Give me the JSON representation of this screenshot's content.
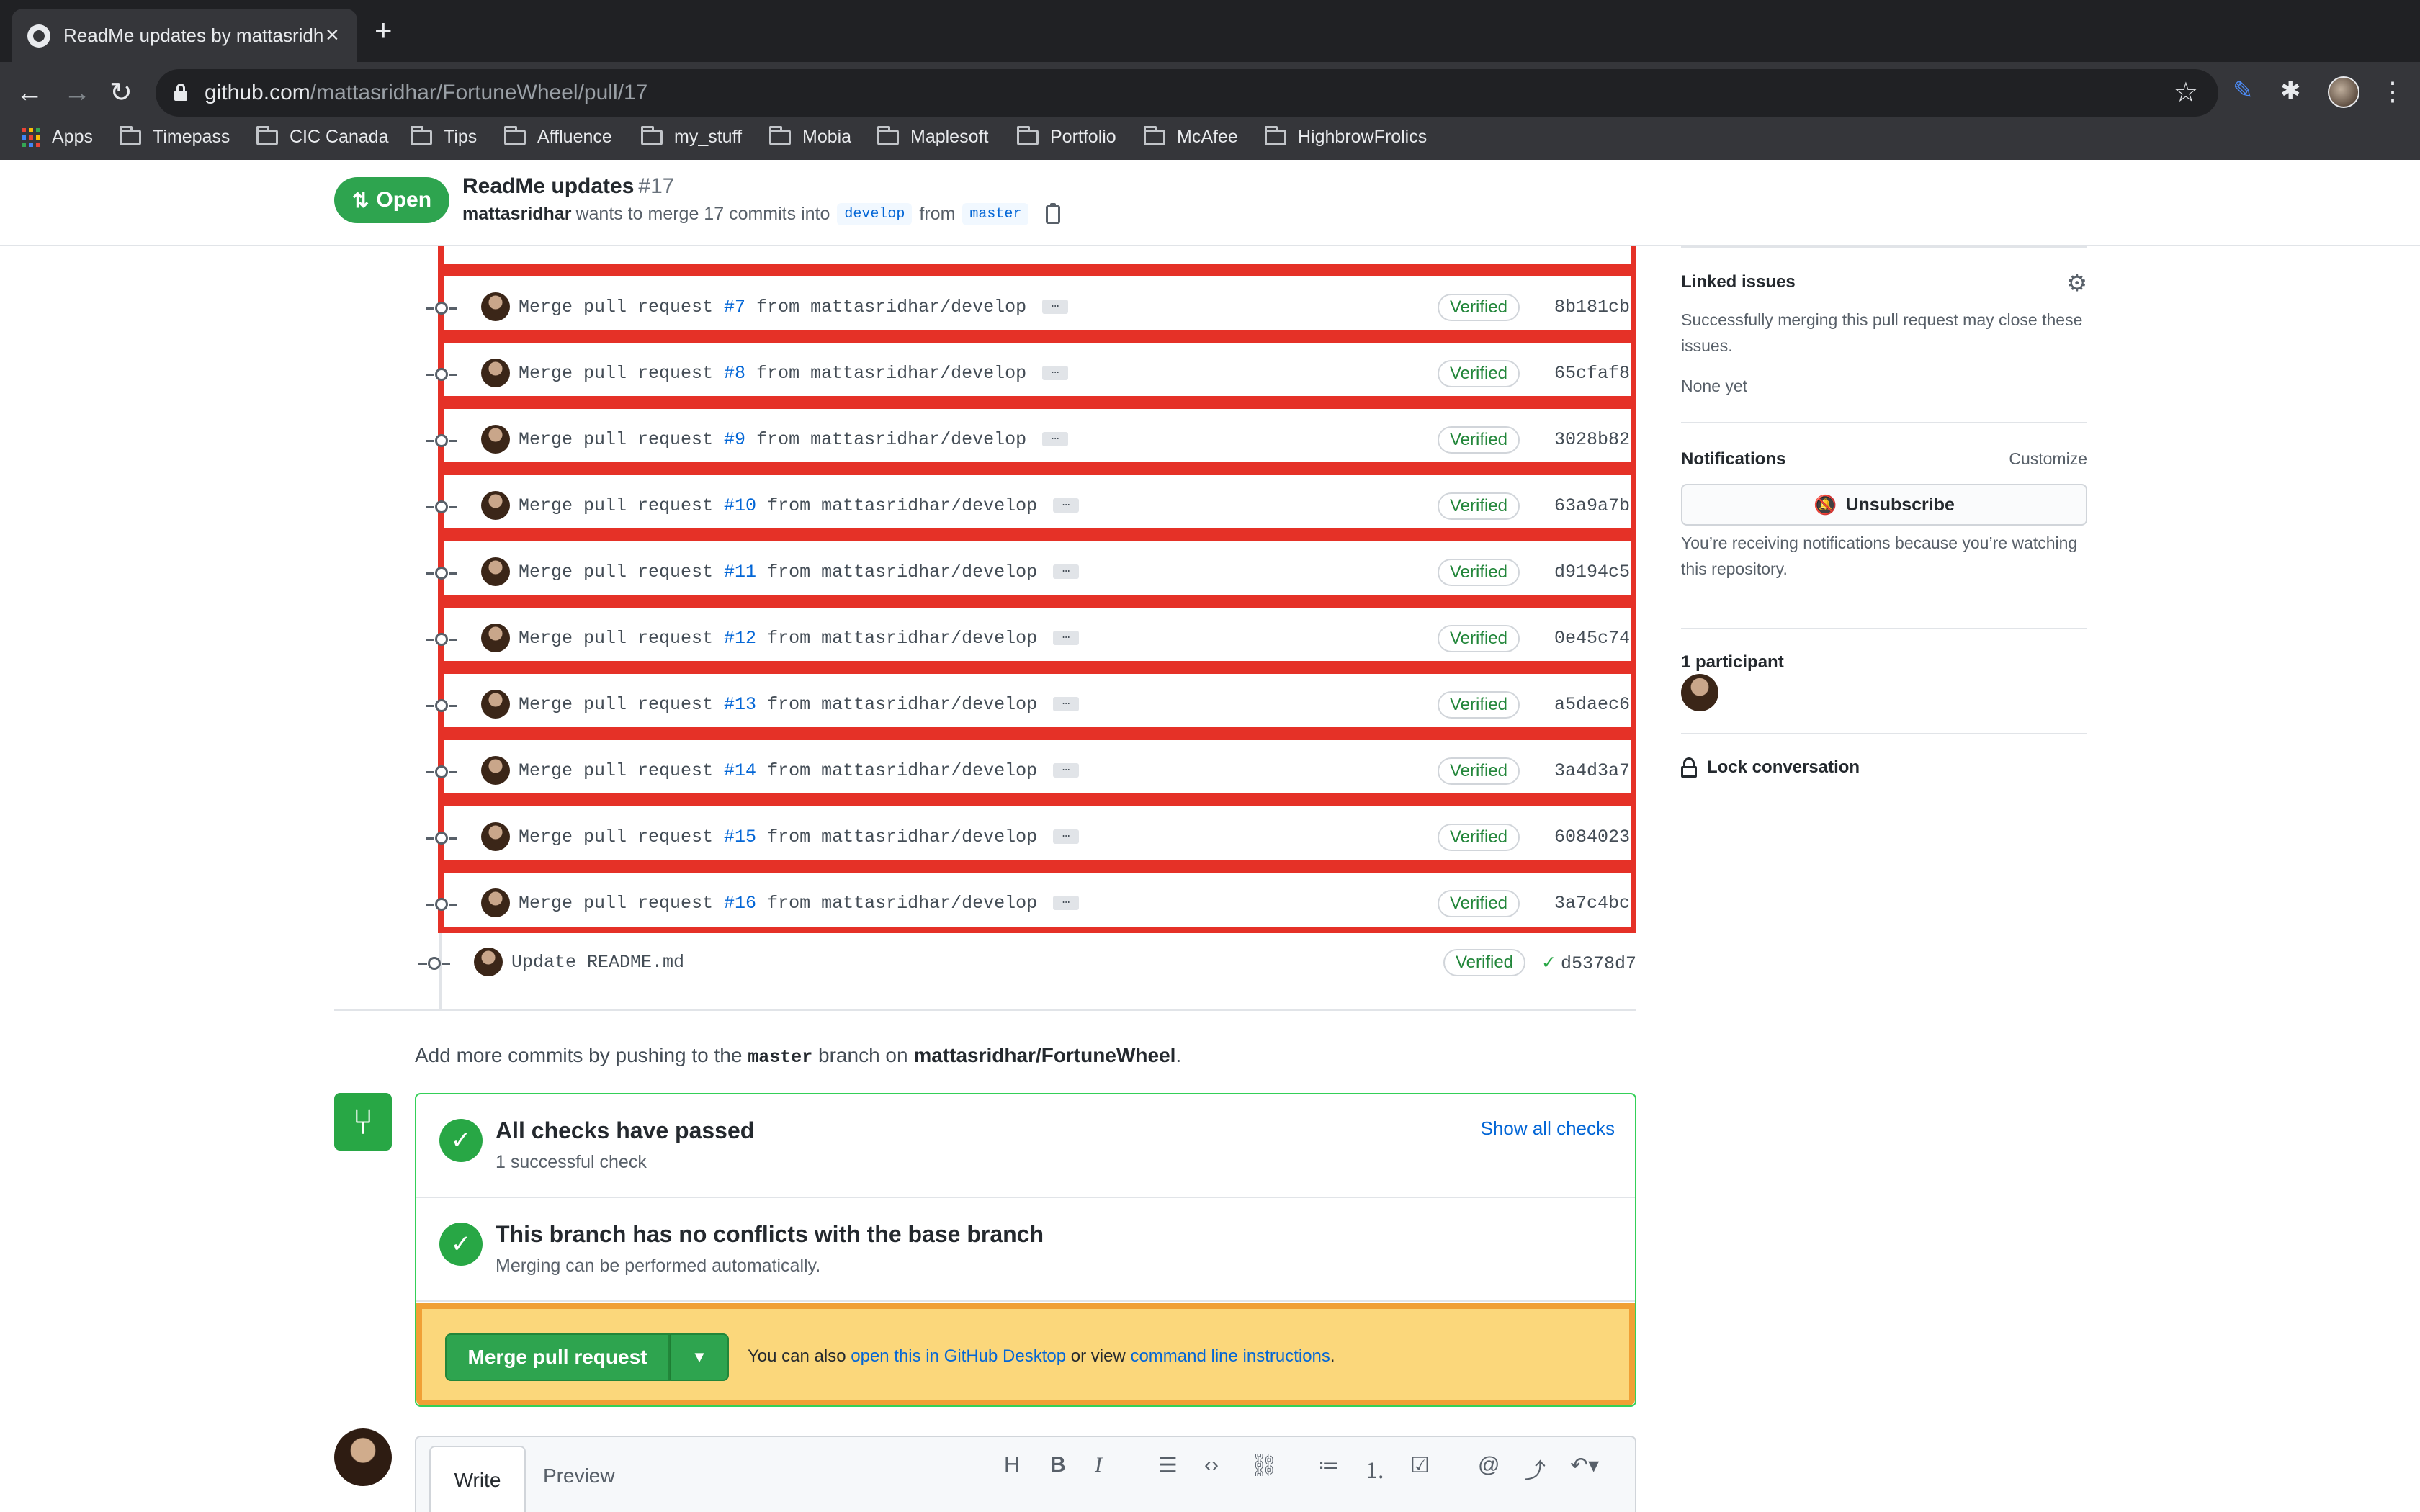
{
  "browser": {
    "tab_title": "ReadMe updates by mattasridhar",
    "url_host": "github.com",
    "url_path": "/mattasridhar/FortuneWheel/pull/17",
    "bookmarks": [
      "Apps",
      "Timepass",
      "CIC Canada",
      "Tips",
      "Affluence",
      "my_stuff",
      "Mobia",
      "Maplesoft",
      "Portfolio",
      "McAfee",
      "HighbrowFrolics"
    ]
  },
  "pr_header": {
    "status": "Open",
    "title": "ReadMe updates",
    "number": "#17",
    "author": "mattasridhar",
    "meta_text": "wants to merge 17 commits into",
    "base_branch": "develop",
    "from_text": "from",
    "head_branch": "master"
  },
  "commits": [
    {
      "prefix": "Merge pull request ",
      "pr": "#7",
      "suffix": " from mattasridhar/develop",
      "badge": "Verified",
      "sha": "8b181cb"
    },
    {
      "prefix": "Merge pull request ",
      "pr": "#8",
      "suffix": " from mattasridhar/develop",
      "badge": "Verified",
      "sha": "65cfaf8"
    },
    {
      "prefix": "Merge pull request ",
      "pr": "#9",
      "suffix": " from mattasridhar/develop",
      "badge": "Verified",
      "sha": "3028b82"
    },
    {
      "prefix": "Merge pull request ",
      "pr": "#10",
      "suffix": " from mattasridhar/develop",
      "badge": "Verified",
      "sha": "63a9a7b"
    },
    {
      "prefix": "Merge pull request ",
      "pr": "#11",
      "suffix": " from mattasridhar/develop",
      "badge": "Verified",
      "sha": "d9194c5"
    },
    {
      "prefix": "Merge pull request ",
      "pr": "#12",
      "suffix": " from mattasridhar/develop",
      "badge": "Verified",
      "sha": "0e45c74"
    },
    {
      "prefix": "Merge pull request ",
      "pr": "#13",
      "suffix": " from mattasridhar/develop",
      "badge": "Verified",
      "sha": "a5daec6"
    },
    {
      "prefix": "Merge pull request ",
      "pr": "#14",
      "suffix": " from mattasridhar/develop",
      "badge": "Verified",
      "sha": "3a4d3a7"
    },
    {
      "prefix": "Merge pull request ",
      "pr": "#15",
      "suffix": " from mattasridhar/develop",
      "badge": "Verified",
      "sha": "6084023"
    },
    {
      "prefix": "Merge pull request ",
      "pr": "#16",
      "suffix": " from mattasridhar/develop",
      "badge": "Verified",
      "sha": "3a7c4bc"
    }
  ],
  "last_commit": {
    "message": "Update README.md",
    "badge": "Verified",
    "sha": "d5378d7"
  },
  "sidebar": {
    "linked_issues_title": "Linked issues",
    "linked_issues_desc": "Successfully merging this pull request may close these issues.",
    "linked_issues_none": "None yet",
    "notifications_title": "Notifications",
    "customize": "Customize",
    "unsubscribe": "Unsubscribe",
    "notifications_reason": "You’re receiving notifications because you’re watching this repository.",
    "participants": "1 participant",
    "lock": "Lock conversation"
  },
  "merge": {
    "add_commits_prefix": "Add more commits by pushing to the",
    "branch": "master",
    "add_commits_middle": "branch on",
    "repo": "mattasridhar/FortuneWheel",
    "checks_title": "All checks have passed",
    "checks_sub": "1 successful check",
    "show_all_checks": "Show all checks",
    "conflicts_title": "This branch has no conflicts with the base branch",
    "conflicts_sub": "Merging can be performed automatically.",
    "merge_button": "Merge pull request",
    "note_prefix": "You can also",
    "note_link1": "open this in GitHub Desktop",
    "note_middle": "or view",
    "note_link2": "command line instructions",
    "note_end": "."
  },
  "composer": {
    "tab_write": "Write",
    "tab_preview": "Preview"
  },
  "colors": {
    "highlight": "#e53127",
    "merge_footer_bg": "#fbd77b",
    "merge_footer_border": "#f0a035",
    "success": "#2ea44f"
  }
}
